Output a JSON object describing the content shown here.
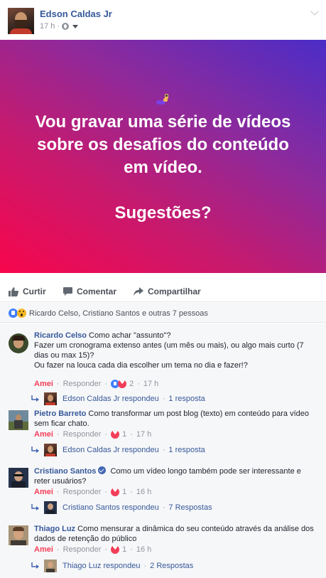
{
  "post": {
    "author": "Edson Caldas Jr",
    "time": "17 h",
    "separator": "·",
    "banner_lines": [
      "Vou gravar uma série de vídeos",
      "sobre os desafios do conteúdo",
      "em vídeo.",
      "Sugestões?"
    ]
  },
  "actions": {
    "like": "Curtir",
    "comment": "Comentar",
    "share": "Compartilhar"
  },
  "reactions": {
    "summary": "Ricardo Celso, Cristiano Santos e outras 7 pessoas"
  },
  "colors": {
    "link": "#365899",
    "love": "#f33e58",
    "like": "#4080ff",
    "banner_start": "#f8064c",
    "banner_end": "#4b2dc7"
  },
  "comments": [
    {
      "name": "Ricardo Celso",
      "text_lines": [
        "Como achar \"assunto\"?",
        "Fazer um cronograma extenso antes (um mês ou mais), ou algo mais curto (7",
        "dias ou max 15)?",
        "Ou fazer na louca cada dia escolher um tema no dia e fazer!?"
      ],
      "react": "Amei",
      "reply": "Responder",
      "reaction_count": "2",
      "time": "17 h",
      "reply_summary": {
        "name": "Edson Caldas Jr respondeu",
        "count": "1 resposta"
      }
    },
    {
      "name": "Pietro Barreto",
      "text_lines": [
        "Como transformar um post blog (texto) em conteúdo para vídeo",
        "sem ficar chato."
      ],
      "react": "Amei",
      "reply": "Responder",
      "reaction_count": "1",
      "time": "17 h",
      "reply_summary": {
        "name": "Edson Caldas Jr respondeu",
        "count": "1 resposta"
      }
    },
    {
      "name": "Cristiano Santos",
      "text_lines": [
        "Como um vídeo longo também pode ser interessante e",
        "reter usuários?"
      ],
      "react": "Amei",
      "reply": "Responder",
      "reaction_count": "1",
      "time": "16 h",
      "reply_summary": {
        "name": "Cristiano Santos respondeu",
        "count": "7 Respostas"
      }
    },
    {
      "name": "Thiago Luz",
      "text_lines": [
        "Como mensurar a dinâmica do seu conteúdo através da análise dos",
        "dados de retenção do público"
      ],
      "react": "Amei",
      "reply": "Responder",
      "reaction_count": "1",
      "time": "16 h",
      "reply_summary": {
        "name": "Thiago Luz respondeu",
        "count": "2 Respostas"
      }
    }
  ]
}
